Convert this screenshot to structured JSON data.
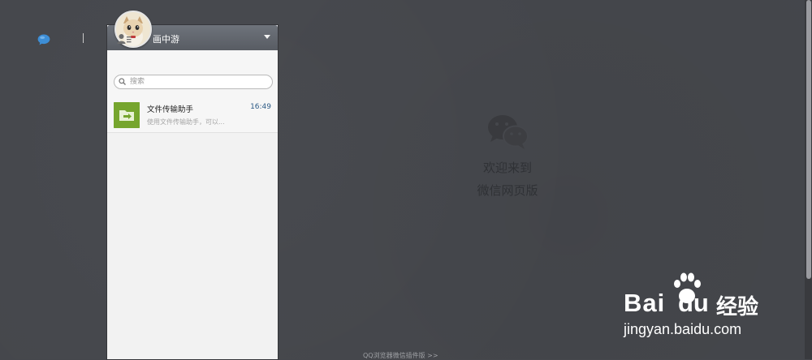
{
  "user": {
    "name": "画中游",
    "avatar_icon": "cat-avatar-icon"
  },
  "tabs": [
    {
      "id": "chat",
      "icon": "chat-bubble-icon",
      "active": true
    },
    {
      "id": "contacts",
      "icon": "contacts-icon",
      "active": false
    }
  ],
  "search": {
    "placeholder": "搜索"
  },
  "chats": [
    {
      "title": "文件传输助手",
      "preview": "使用文件传输助手，可以...",
      "time": "16:49",
      "icon": "file-transfer-icon"
    }
  ],
  "welcome": {
    "line1": "欢迎来到",
    "line2": "微信网页版",
    "icon": "wechat-logo-icon"
  },
  "footer": {
    "text": "QQ浏览器微信插件版 >>"
  },
  "watermark": {
    "brand_bai": "Bai",
    "brand_du": "du",
    "brand_cn": "经验",
    "url": "jingyan.baidu.com"
  },
  "colors": {
    "background": "#45474c",
    "panel": "#f2f2f2",
    "header": "#62666d",
    "accent_blue": "#2d5b86",
    "file_transfer_green": "#76a52e"
  }
}
